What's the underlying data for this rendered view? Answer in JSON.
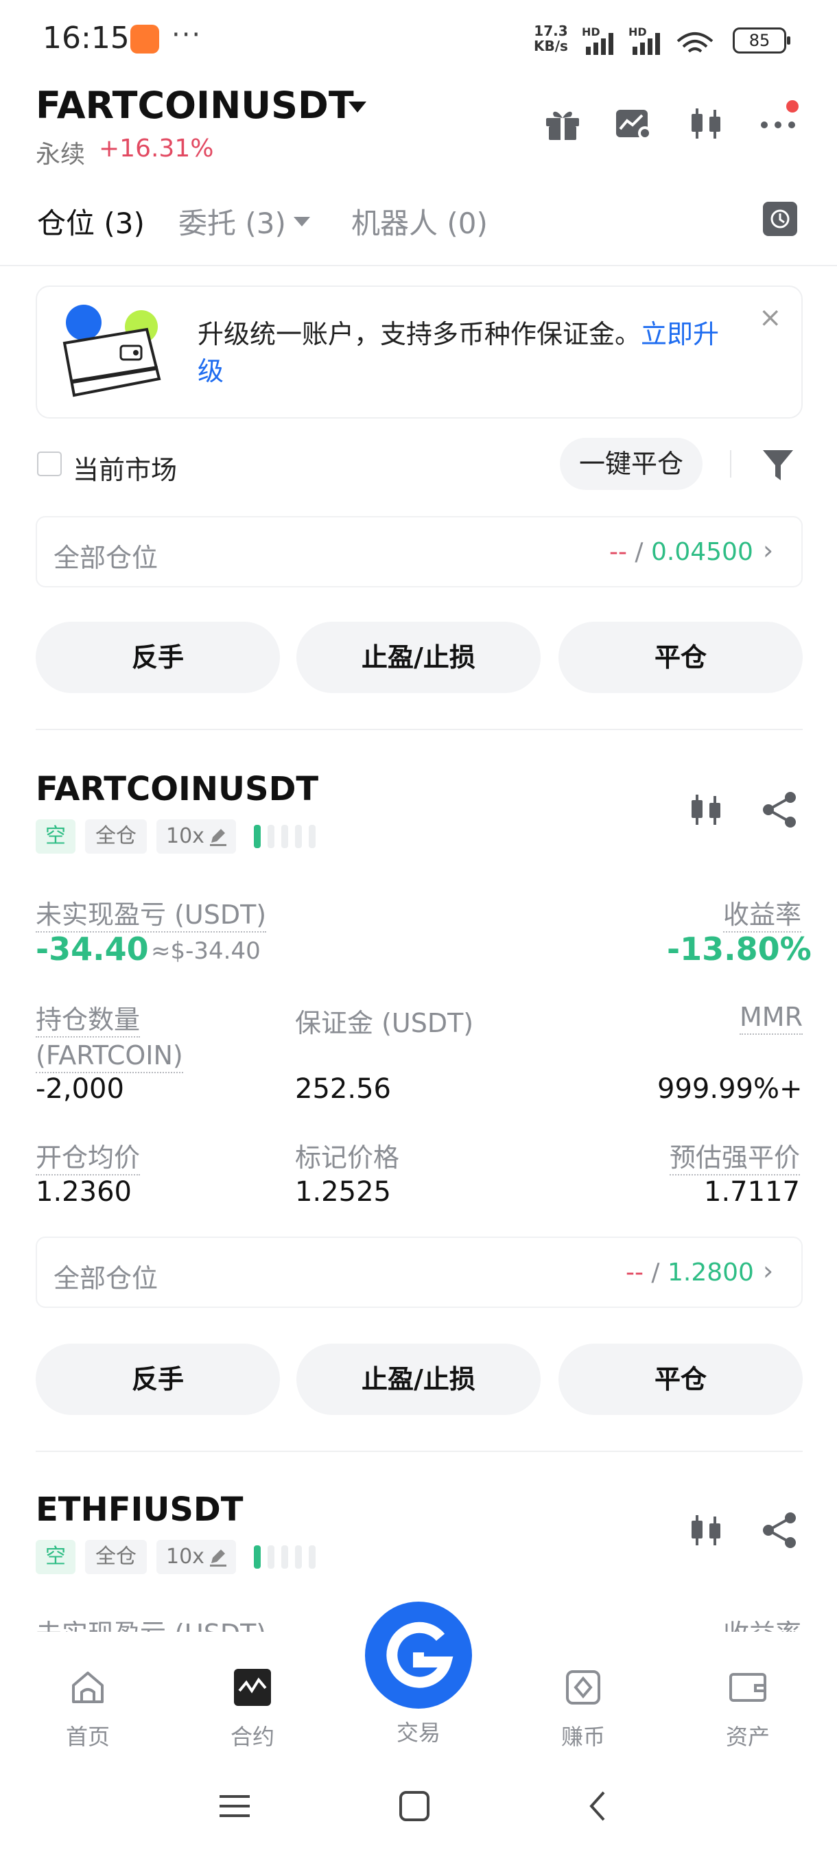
{
  "status_bar": {
    "time": "16:15",
    "dots": "···",
    "speed_top": "17.3",
    "speed_unit": "KB/s",
    "battery": "85"
  },
  "header": {
    "pair": "FARTCOINUSDT",
    "type": "永续",
    "change": "+16.31%"
  },
  "tabs": {
    "positions": "仓位 (3)",
    "orders": "委托 (3)",
    "bots": "机器人 (0)"
  },
  "banner": {
    "text": "升级统一账户，支持多币种作保证金。",
    "link": "立即升级",
    "close": "×"
  },
  "filter": {
    "current_market": "当前市场",
    "one_click_close": "一键平仓"
  },
  "all_positions_top": {
    "label": "全部仓位",
    "value_a": "--",
    "sep": " / ",
    "value_b": "0.04500"
  },
  "actions": {
    "reverse": "反手",
    "tp_sl": "止盈/止损",
    "close": "平仓"
  },
  "position1": {
    "symbol": "FARTCOINUSDT",
    "side": "空",
    "margin_mode": "全仓",
    "leverage": "10x",
    "unrealized_label": "未实现盈亏 (USDT)",
    "unrealized_value": "-34.40",
    "unrealized_approx": "≈$-34.40",
    "roe_label": "收益率",
    "roe_value": "-13.80%",
    "size_label_1": "持仓数量",
    "size_label_2": "(FARTCOIN)",
    "size_value": "-2,000",
    "margin_label": "保证金 (USDT)",
    "margin_value": "252.56",
    "mmr_label": "MMR",
    "mmr_value": "999.99%+",
    "entry_label": "开仓均价",
    "entry_value": "1.2360",
    "mark_label": "标记价格",
    "mark_value": "1.2525",
    "liq_label": "预估强平价",
    "liq_value": "1.7117",
    "all_label": "全部仓位",
    "all_value_a": "--",
    "all_sep": " / ",
    "all_value_b": "1.2800"
  },
  "position2": {
    "symbol": "ETHFIUSDT",
    "side": "空",
    "margin_mode": "全仓",
    "leverage": "10x",
    "unrealized_label": "未实现盈亏 (USDT)",
    "roe_label": "收益率"
  },
  "bottom_nav": {
    "home": "首页",
    "futures": "合约",
    "trade": "交易",
    "earn": "赚币",
    "assets": "资产"
  },
  "colors": {
    "green": "#2ebd85",
    "red": "#e24a62",
    "orange": "#f0a04b",
    "link_blue": "#1e6cf0"
  }
}
